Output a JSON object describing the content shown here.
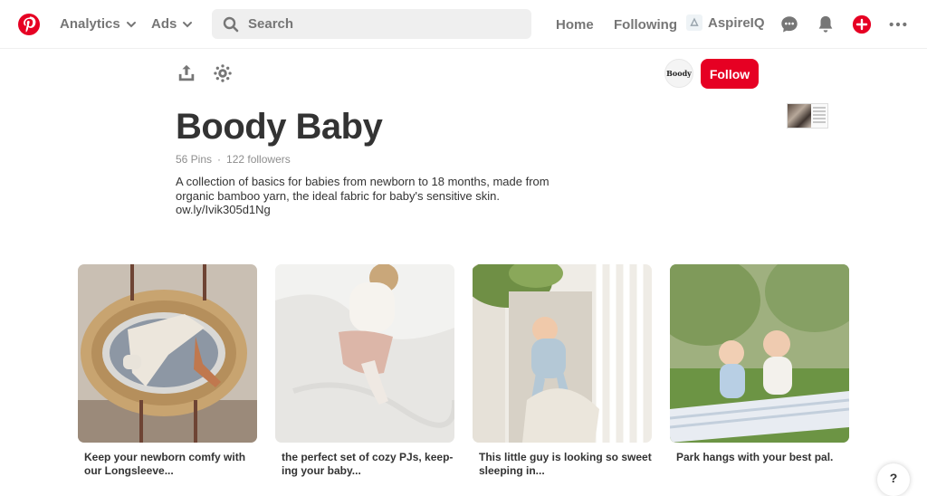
{
  "topbar": {
    "analytics_label": "Analytics",
    "ads_label": "Ads",
    "search_placeholder": "Search",
    "home_label": "Home",
    "following_label": "Following",
    "profile_name": "AspireIQ"
  },
  "board": {
    "title": "Boody Baby",
    "pins_count": "56 Pins",
    "separator": "·",
    "followers_count": "122 followers",
    "description_lines": [
      "A collection of basics for babies from newborn to 18 months, made from",
      "organic bamboo yarn, the ideal fabric for baby's sensitive skin.",
      "ow.ly/Ivik305d1Ng"
    ],
    "follow_label": "Follow",
    "owner_avatar_text": "Boody"
  },
  "pins": [
    {
      "caption_lines": [
        "Keep your newborn comfy with",
        "our Longsleeve..."
      ]
    },
    {
      "caption_lines": [
        "the perfect set of cozy PJs, keep-",
        "ing your baby..."
      ]
    },
    {
      "caption_lines": [
        "This little guy is looking so sweet",
        "sleeping in..."
      ]
    },
    {
      "caption_lines": [
        "Park hangs with your best pal."
      ]
    }
  ],
  "help_label": "?",
  "colors": {
    "brand_red": "#e60023",
    "text_gray": "#767676",
    "search_bg": "#efefef"
  },
  "icons": [
    "pinterest-logo-icon",
    "chevron-down-icon",
    "search-icon",
    "chat-icon",
    "bell-icon",
    "add-icon",
    "more-icon",
    "share-icon",
    "settings-icon"
  ]
}
